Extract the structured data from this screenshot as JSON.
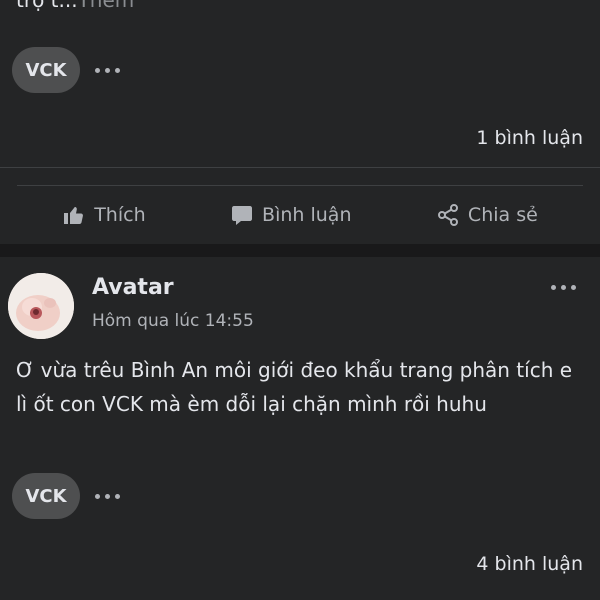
{
  "post1": {
    "truncated_text": "trọ t...",
    "more_label": "Thêm",
    "tag_label": "VCK",
    "comment_count": "1 bình luận",
    "actions": {
      "like_label": "Thích",
      "comment_label": "Bình luận",
      "share_label": "Chia sẻ"
    }
  },
  "post2": {
    "author": "Avatar",
    "timestamp": "Hôm qua lúc 14:55",
    "text": "Ơ vừa trêu Bình An môi giới đeo khẩu trang phân tích e lì ốt con VCK mà èm dỗi lại chặn mình rồi huhu",
    "tag_label": "VCK",
    "comment_count": "4 bình luận"
  },
  "icons": {
    "like": "thumbs-up-icon",
    "comment": "speech-bubble-icon",
    "share": "share-icon",
    "more": "more-dots-icon"
  },
  "colors": {
    "background": "#19191a",
    "card": "#242526",
    "text_primary": "#e4e6eb",
    "text_secondary": "#b0b3b8",
    "pill": "#4e4f50"
  }
}
